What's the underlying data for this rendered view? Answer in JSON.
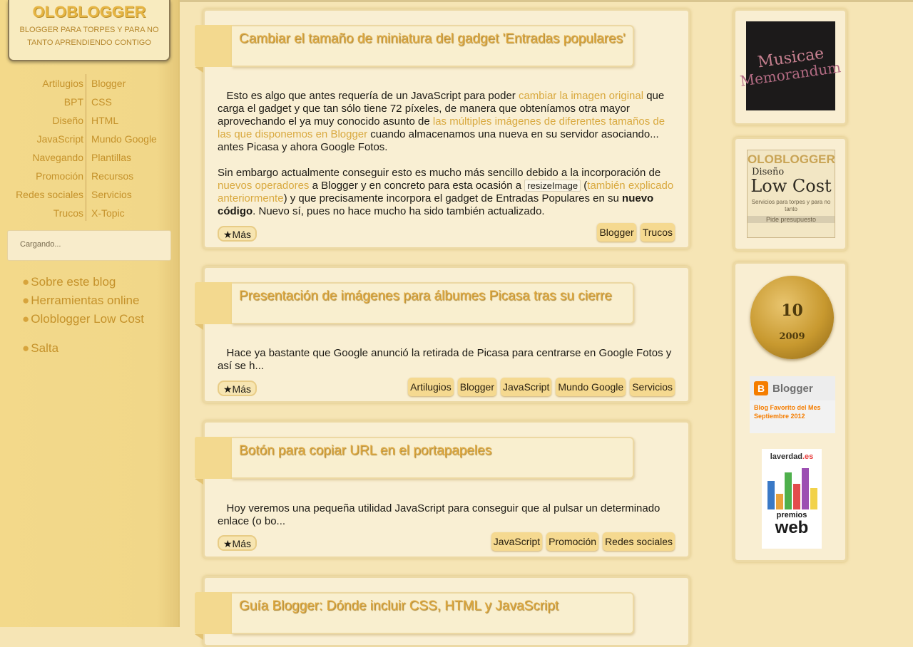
{
  "blog": {
    "title": "OLOBLOGGER",
    "subtitle": "BLOGGER PARA TORPES Y PARA NO TANTO APRENDIENDO CONTIGO"
  },
  "categories": {
    "left": [
      "Artilugios",
      "BPT",
      "Diseño",
      "JavaScript",
      "Navegando",
      "Promoción",
      "Redes sociales",
      "Trucos"
    ],
    "right": [
      "Blogger",
      "CSS",
      "HTML",
      "Mundo Google",
      "Plantillas",
      "Recursos",
      "Servicios",
      "X-Topic"
    ]
  },
  "search": {
    "loading_text": "Cargando..."
  },
  "side_links": [
    "Sobre este blog",
    "Herramientas online",
    "Oloblogger Low Cost",
    "Salta"
  ],
  "side_bullet": "●",
  "posts": [
    {
      "title": "Cambiar el tamaño de miniatura del gadget 'Entradas populares'",
      "p1_a": "Esto es algo que antes requería de un JavaScript para poder ",
      "p1_link1": "cambiar la imagen original",
      "p1_b": " que carga el gadget y que tan sólo tiene 72 píxeles, de manera que obteníamos otra mayor aprovechando el ya muy conocido asunto de ",
      "p1_link2": "las múltiples imágenes de diferentes tamaños de las que disponemos en Blogger",
      "p1_c": " cuando almacenamos una nueva en su servidor asociando... antes Picasa y ahora Google Fotos.",
      "p2_a": "Sin embargo actualmente conseguir esto es mucho más sencillo debido a la incorporación de ",
      "p2_link1": "nuevos operadores",
      "p2_b": " a Blogger y en concreto para esta ocasión a ",
      "p2_code": "resizeImage",
      "p2_c": " (",
      "p2_link2": "también explicado anteriormente",
      "p2_d": ") y que precisamente incorpora el gadget de Entradas Populares en su ",
      "p2_bold": "nuevo código",
      "p2_e": ". Nuevo sí, pues no hace mucho ha sido también actualizado.",
      "more": "★Más",
      "tags": [
        "Blogger",
        "Trucos"
      ]
    },
    {
      "title": "Presentación de imágenes para álbumes Picasa tras su cierre",
      "excerpt": "Hace ya bastante que Google anunció la retirada de Picasa  para centrarse en Google Fotos y así se h...",
      "more": "★Más",
      "tags": [
        "Artilugios",
        "Blogger",
        "JavaScript",
        "Mundo Google",
        "Servicios"
      ]
    },
    {
      "title": "Botón para copiar URL en el portapapeles",
      "excerpt": "Hoy veremos una pequeña utilidad JavaScript para conseguir que al pulsar un determinado enlace (o bo...",
      "more": "★Más",
      "tags": [
        "JavaScript",
        "Promoción",
        "Redes sociales"
      ]
    },
    {
      "title": "Guía Blogger: Dónde incluir CSS, HTML y JavaScript"
    }
  ],
  "widgets": {
    "musicae": {
      "line1": "Musicae",
      "line2": "Memorandum"
    },
    "lowcost": {
      "brand": "OLOBLOGGER",
      "line1": "Diseño",
      "line2": "Low Cost",
      "text": "Servicios para torpes y para no tanto",
      "cta": "Pide presupuesto"
    },
    "coin": {
      "number": "10",
      "year": "2009"
    },
    "blogger_award": {
      "icon": "B",
      "name": "Blogger",
      "text": "Blog Favorito del Mes Septiembre 2012"
    },
    "verdad": {
      "brand_main": "laverdad",
      "brand_ext": ".es",
      "premios": "premios",
      "web": "web"
    }
  },
  "colors": {
    "background": "#f6e5b5",
    "sidebar": "#f3d98a",
    "link": "#d9a93f",
    "title": "#dfa83d",
    "tag": "#f5d990"
  }
}
